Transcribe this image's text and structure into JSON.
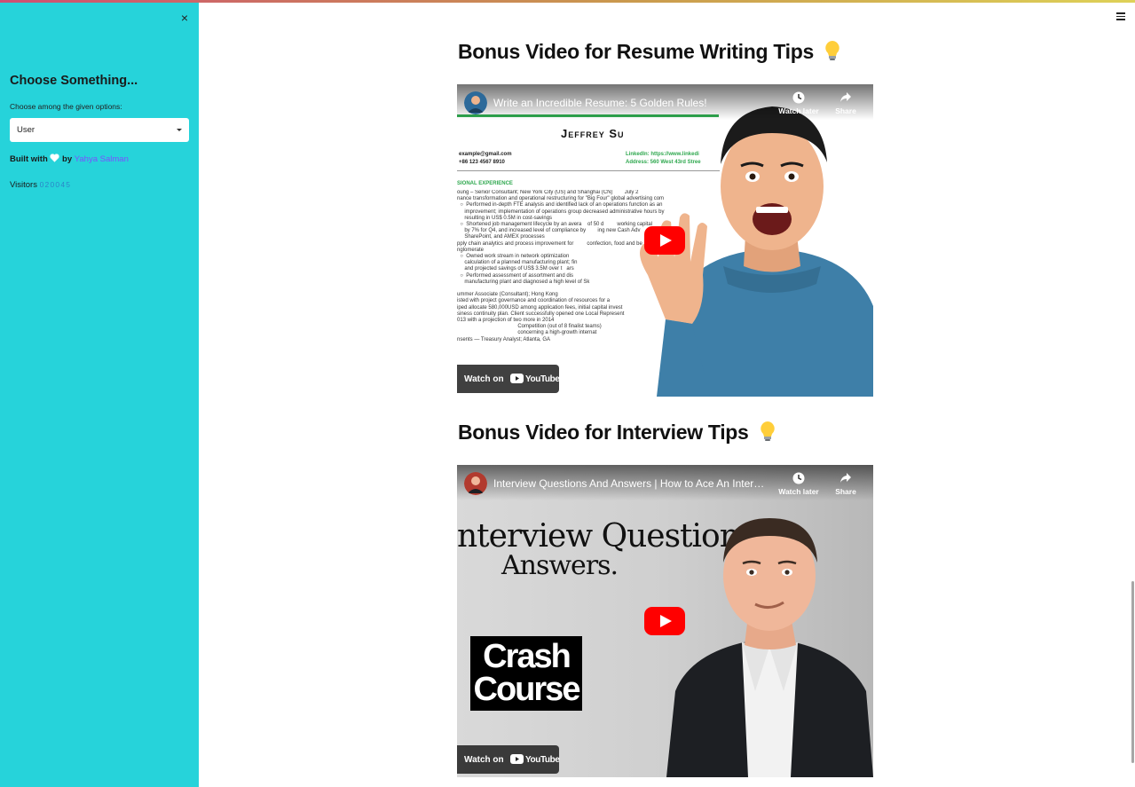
{
  "sidebar": {
    "close_glyph": "×",
    "title": "Choose Something...",
    "select_label": "Choose among the given options:",
    "select_value": "User",
    "built_prefix": "Built with",
    "built_by": "by",
    "author": "Yahya Salman",
    "visitors_label": "Visitors",
    "visitors_count": "020045"
  },
  "main": {
    "sections": [
      {
        "heading": "Bonus Video for Resume Writing Tips",
        "video": {
          "title": "Write an Incredible Resume: 5 Golden Rules!",
          "watch_later": "Watch later",
          "share": "Share",
          "watch_on": "Watch on",
          "youtube": "YouTube",
          "thumbnail": {
            "name": "Jeffrey Su",
            "email": "example@gmail.com",
            "phone": "+86 123 4567 8910",
            "linkedin": "LinkedIn: https://www.linkedi",
            "address": "Address: 560 West 43rd Stree",
            "section": "SIONAL EXPERIENCE",
            "lines": [
              "oung – Senior Consultant; New York City (US) and Shanghai (CN)        July 2",
              "nance transformation and operational restructuring for \"Big Four\" global advertising com",
              "  ○  Performed in-depth FTE analysis and identified lack of an operations function as an",
              "     improvement; implementation of operations group decreased administrative hours by",
              "     resulting in US$ 0.5M in cost-savings",
              "  ○  Shortened job management lifecycle by an avera    of 50 d         working capital",
              "     by 7% for Q4, and increased level of compliance by        ing new Cash Adv",
              "     SharePoint, and AMEX processes",
              "pply chain analytics and process improvement for         confection, food and be",
              "nglomerate",
              "  ○  Owned work stream in network optimization",
              "     calculation of a planned manufacturing plant; fin",
              "     and projected savings of US$ 3.5M over t   ars",
              "  ○  Performed assessment of assortment and dis",
              "     manufacturing plant and diagnosed a high level of Sk",
              "",
              "ummer Associate (Consultant); Hong Kong",
              "isted with project governance and coordination of resources for a",
              "iped allocate 580,000USD among application fees, initial capital invest",
              "siness continuity plan. Client successfully opened one Local Represent",
              "013 with a projection of two more in 2014",
              "                                         Competition (out of 8 finalist teams)",
              "                                         concerning a high-growth internat",
              "nsents — Treasury Analyst; Atlanta, GA"
            ]
          }
        }
      },
      {
        "heading": "Bonus Video for Interview Tips",
        "video": {
          "title": "Interview Questions And Answers | How to Ace An Intervi...",
          "watch_later": "Watch later",
          "share": "Share",
          "watch_on": "Watch on",
          "youtube": "YouTube",
          "thumbnail": {
            "headline_1": "nterview Question",
            "headline_2": "Answers.",
            "badge_1": "Crash",
            "badge_2": "Course"
          }
        }
      }
    ]
  },
  "colors": {
    "sidebar_bg": "#26d3da",
    "link": "#7b4fff",
    "counter": "#2b87c9",
    "youtube_red": "#ff0000"
  },
  "icons": [
    "close-icon",
    "heart-icon",
    "lightbulb-icon",
    "clock-icon",
    "share-icon",
    "play-icon",
    "youtube-logo-icon",
    "hamburger-menu-icon"
  ]
}
